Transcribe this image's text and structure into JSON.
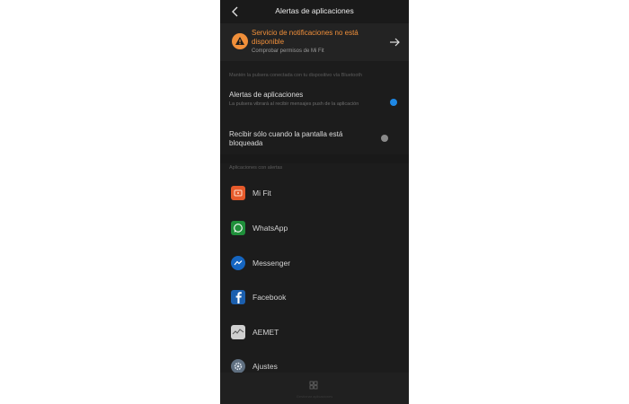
{
  "header": {
    "title": "Alertas de aplicaciones"
  },
  "notice": {
    "title": "Servicio de notificaciones no está disponible",
    "subtitle": "Comprobar permisos de Mi Fit"
  },
  "section_hint": "Mantén la pulsera conectada con tu dispositivo vía Bluetooth",
  "settings": [
    {
      "label": "Alertas de aplicaciones",
      "description": "La pulsera vibrará al recibir mensajes push de la aplicación",
      "state": "on"
    },
    {
      "label": "Recibir sólo cuando la pantalla está bloqueada",
      "state": "off"
    }
  ],
  "apps_header": "Aplicaciones con alertas",
  "apps": [
    {
      "name": "Mi Fit",
      "icon": "mifit-icon"
    },
    {
      "name": "WhatsApp",
      "icon": "whatsapp-icon"
    },
    {
      "name": "Messenger",
      "icon": "messenger-icon"
    },
    {
      "name": "Facebook",
      "icon": "facebook-icon"
    },
    {
      "name": "AEMET",
      "icon": "aemet-icon"
    },
    {
      "name": "Ajustes",
      "icon": "settings-icon"
    }
  ],
  "bottom": {
    "label": "Gestionar aplicaciones"
  },
  "colors": {
    "warning": "#f08f3a",
    "toggle_on": "#1e88e5",
    "toggle_off": "#8a8a8a",
    "whatsapp": "#1f8f3a",
    "messenger": "#1565c0",
    "facebook": "#1b5fae",
    "mifit": "#e65a2b"
  }
}
